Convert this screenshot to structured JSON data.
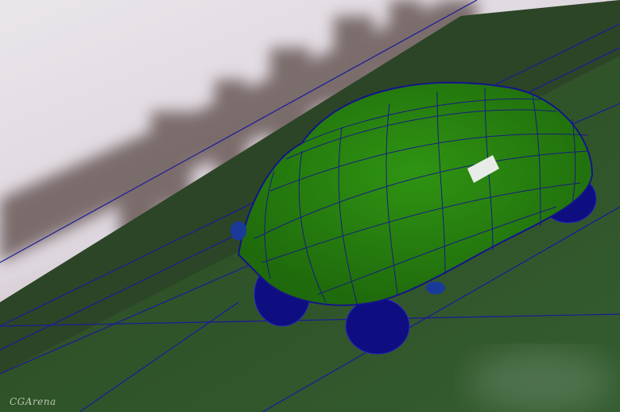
{
  "watermark": "CGArena",
  "colors": {
    "sky": "#e8e4e8",
    "ground": "#2f5429",
    "car_body": "#2f8a12",
    "wireframe": "#14148a"
  }
}
